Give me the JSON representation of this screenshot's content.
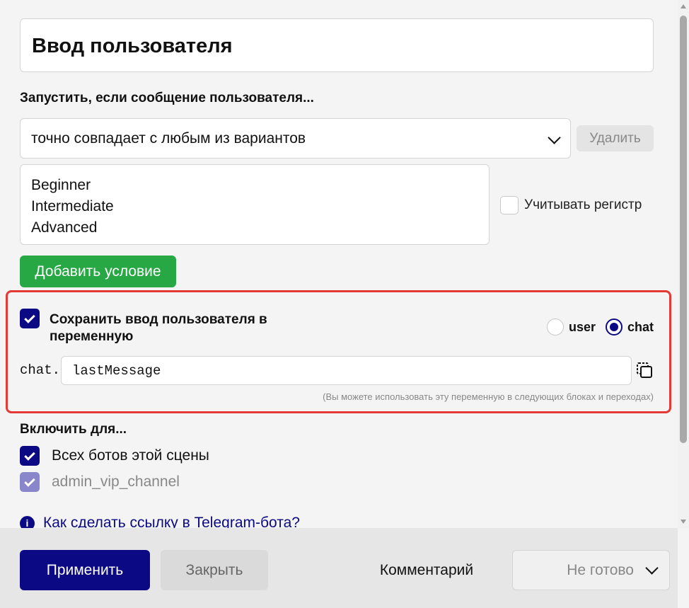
{
  "title": "Ввод пользователя",
  "trigger": {
    "label": "Запустить, если сообщение пользователя...",
    "match_mode": "точно совпадает с любым из вариантов",
    "delete_label": "Удалить",
    "variants": [
      "Beginner",
      "Intermediate",
      "Advanced"
    ],
    "case_sensitive_label": "Учитывать регистр",
    "case_sensitive": false,
    "add_condition_label": "Добавить условие"
  },
  "save": {
    "checked": true,
    "label": "Сохранить ввод пользователя в переменную",
    "scope_options": [
      "user",
      "chat"
    ],
    "scope_selected": "chat",
    "prefix": "chat.",
    "variable_name": "lastMessage",
    "hint": "(Вы можете использовать эту переменную в следующих блоках и переходах)"
  },
  "enable": {
    "label": "Включить для...",
    "options": [
      {
        "label": "Всех ботов этой сцены",
        "checked": true,
        "disabled": false
      },
      {
        "label": "admin_vip_channel",
        "checked": true,
        "disabled": true
      }
    ]
  },
  "help": {
    "icon": "info-icon",
    "link_text": "Как сделать ссылку в Telegram-бота?"
  },
  "footer": {
    "apply_label": "Применить",
    "close_label": "Закрыть",
    "comment_label": "Комментарий",
    "status_value": "Не готово"
  },
  "colors": {
    "primary": "#0b0a84",
    "success": "#27a844",
    "highlight": "#e53935"
  }
}
